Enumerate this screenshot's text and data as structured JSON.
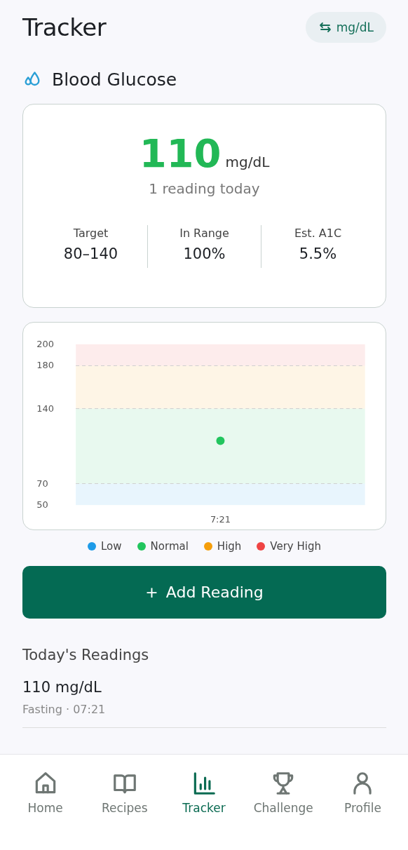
{
  "header": {
    "title": "Tracker",
    "unit_toggle": "mg/dL"
  },
  "section": {
    "title": "Blood Glucose"
  },
  "summary": {
    "value": "110",
    "unit": "mg/dL",
    "caption": "1 reading today",
    "stats": [
      {
        "label": "Target",
        "value": "80–140"
      },
      {
        "label": "In Range",
        "value": "100%"
      },
      {
        "label": "Est. A1C",
        "value": "5.5%"
      }
    ]
  },
  "chart": {
    "chart_data": {
      "type": "scatter",
      "categories": [
        "7:21"
      ],
      "series": [
        {
          "color": "#22c55e",
          "values": [
            110
          ]
        }
      ],
      "ylim": [
        50,
        200
      ],
      "yticks": [
        50,
        70,
        140,
        180,
        200
      ],
      "grid": true
    },
    "legend": [
      {
        "label": "Low",
        "color": "#1e9be8"
      },
      {
        "label": "Normal",
        "color": "#22c55e"
      },
      {
        "label": "High",
        "color": "#f59e0b"
      },
      {
        "label": "Very High",
        "color": "#ef4444"
      }
    ]
  },
  "add_button": {
    "icon": "+",
    "label": "Add Reading"
  },
  "readings": {
    "title": "Today's Readings",
    "items": [
      {
        "value": "110 mg/dL",
        "detail": "Fasting · 07:21"
      }
    ]
  },
  "nav": [
    {
      "label": "Home",
      "selected": false
    },
    {
      "label": "Recipes",
      "selected": false
    },
    {
      "label": "Tracker",
      "selected": true
    },
    {
      "label": "Challenge",
      "selected": false
    },
    {
      "label": "Profile",
      "selected": false
    }
  ]
}
